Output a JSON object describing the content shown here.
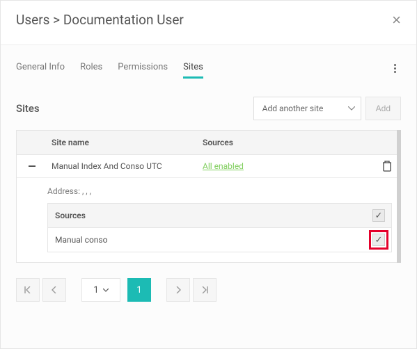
{
  "header": {
    "breadcrumb_root": "Users",
    "breadcrumb_sep": " > ",
    "breadcrumb_leaf": "Documentation User"
  },
  "tabs": {
    "items": [
      "General Info",
      "Roles",
      "Permissions",
      "Sites"
    ],
    "active_index": 3
  },
  "section": {
    "title": "Sites",
    "select_placeholder": "Add another site",
    "add_label": "Add"
  },
  "table": {
    "columns": {
      "name": "Site name",
      "sources": "Sources"
    },
    "rows": [
      {
        "name": "Manual Index And Conso UTC",
        "sources_link": "All enabled",
        "expanded": true,
        "address_label": "Address: , , ,",
        "inner_header": "Sources",
        "inner_rows": [
          {
            "label": "Manual conso",
            "checked": true,
            "highlighted": true
          }
        ],
        "header_checked": true
      }
    ]
  },
  "pager": {
    "page_options": [
      "1"
    ],
    "current": "1"
  }
}
